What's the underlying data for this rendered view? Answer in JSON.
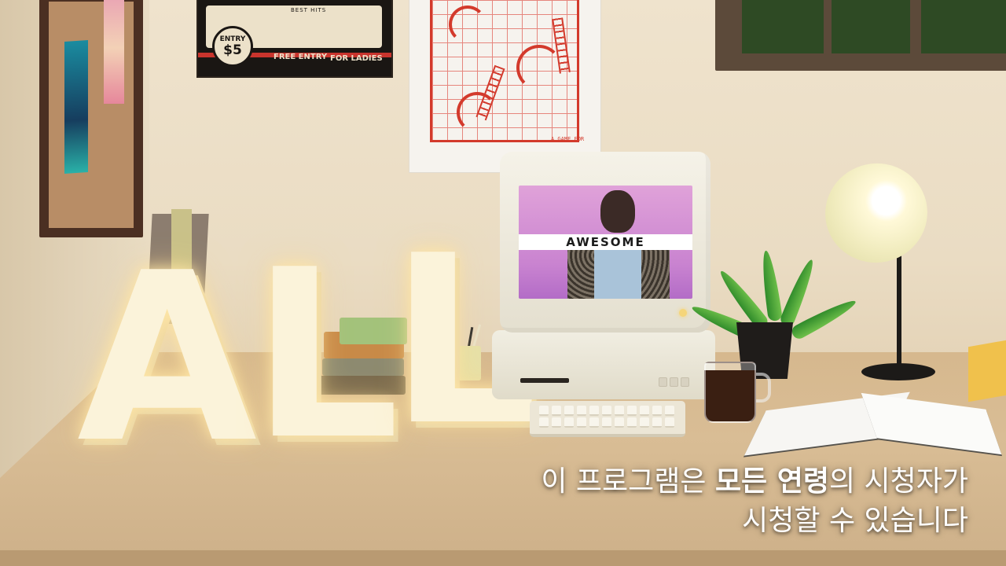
{
  "monitor": {
    "screen_title": "AWESOME"
  },
  "posters": {
    "cassette": {
      "entry_line1": "ENTRY",
      "entry_line2": "$5",
      "best_hits": "BEST HITS",
      "free_entry": "FREE ENTRY",
      "for_ladies": "FOR LADIES"
    },
    "game": {
      "caption": "A GAME FOR"
    }
  },
  "letters": {
    "l1": "A",
    "l2": "L",
    "l3": "L"
  },
  "caption": {
    "line1_a": "이 프로그램은 ",
    "line1_b": "모든 연령",
    "line1_c": "의 시청자가",
    "line2": "시청할 수 있습니다"
  },
  "colors": {
    "wall": "#efe3cd",
    "desk": "#d6b88e",
    "screen_pink": "#e0a2d9",
    "poster_red": "#d33a2c",
    "lamp_shade": "#f0ebbd"
  }
}
